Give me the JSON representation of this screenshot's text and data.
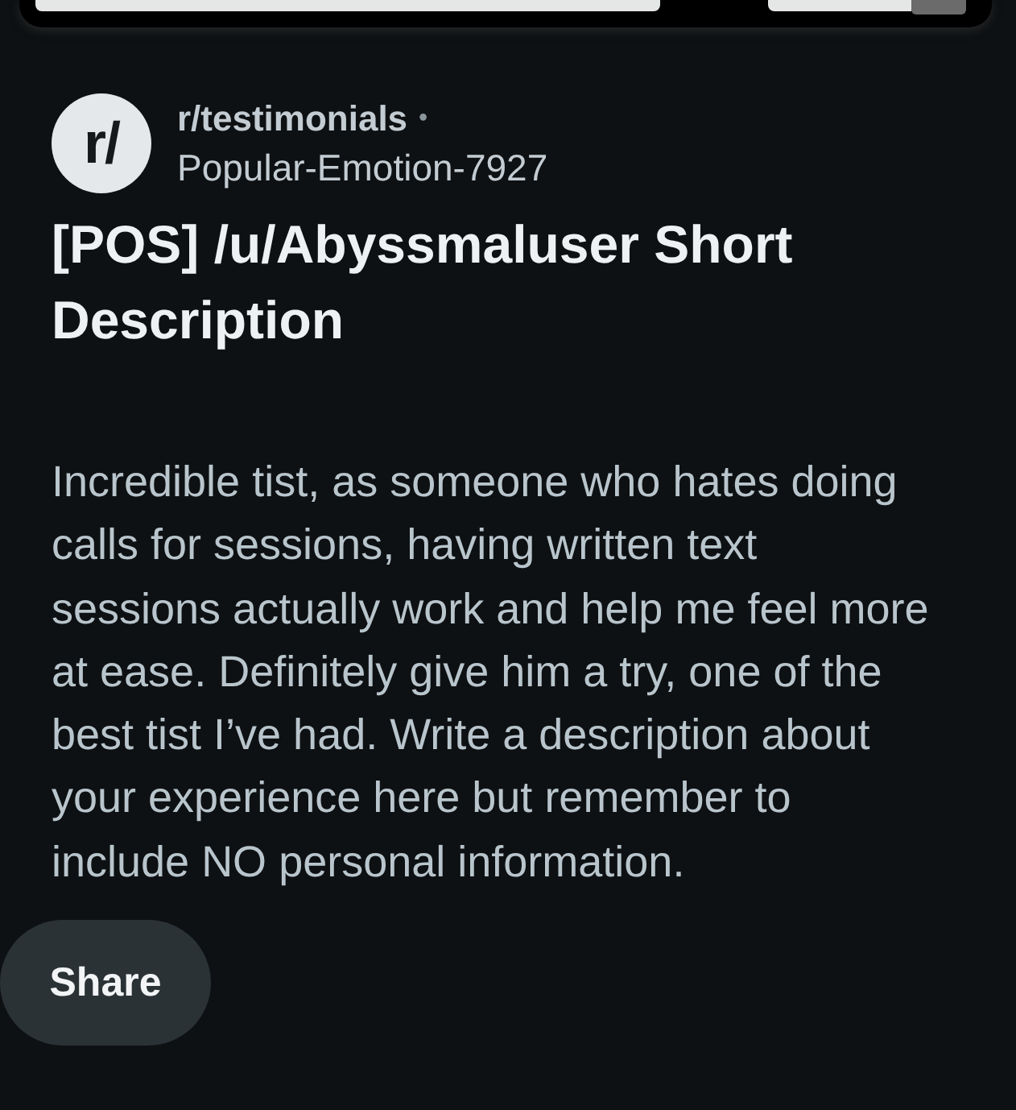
{
  "post": {
    "avatar_text": "r/",
    "community": "r/testimonials",
    "separator": "•",
    "author": "Popular-Emotion-7927",
    "title": "[POS] /u/Abyssmaluser Short Description",
    "body": "Incredible tist, as someone who hates doing calls for sessions, having written text sessions actually work and help me feel more at ease. Definitely give him a try, one of the best tist I’ve had. Write a description about your experience here but remember to include NO personal information."
  },
  "actions": [
    {
      "label": "Share"
    }
  ]
}
